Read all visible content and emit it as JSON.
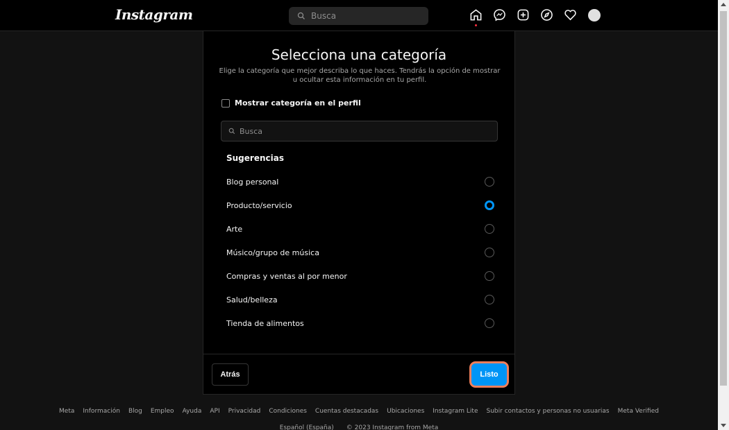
{
  "nav": {
    "logo": "Instagram",
    "search_placeholder": "Busca",
    "icons": [
      "home-icon",
      "messenger-icon",
      "new-post-icon",
      "explore-icon",
      "heart-icon",
      "avatar"
    ],
    "notification_dot_color": "#ff3040"
  },
  "modal": {
    "title": "Selecciona una categoría",
    "subtitle": "Elige la categoría que mejor describa lo que haces. Tendrás la opción de mostrar u ocultar esta información en tu perfil.",
    "show_category_label": "Mostrar categoría en el perfil",
    "show_category_checked": false,
    "search_placeholder": "Busca",
    "suggestions_heading": "Sugerencias",
    "categories": [
      {
        "label": "Blog personal",
        "selected": false
      },
      {
        "label": "Producto/servicio",
        "selected": true
      },
      {
        "label": "Arte",
        "selected": false
      },
      {
        "label": "Músico/grupo de música",
        "selected": false
      },
      {
        "label": "Compras y ventas al por menor",
        "selected": false
      },
      {
        "label": "Salud/belleza",
        "selected": false
      },
      {
        "label": "Tienda de alimentos",
        "selected": false
      }
    ],
    "back_label": "Atrás",
    "done_label": "Listo",
    "accent_color": "#0095f6",
    "highlight_color": "#f07f5b"
  },
  "footer": {
    "links": [
      "Meta",
      "Información",
      "Blog",
      "Empleo",
      "Ayuda",
      "API",
      "Privacidad",
      "Condiciones",
      "Cuentas destacadas",
      "Ubicaciones",
      "Instagram Lite",
      "Subir contactos y personas no usuarias",
      "Meta Verified"
    ],
    "language": "Español (España)",
    "copyright": "© 2023 Instagram from Meta"
  }
}
